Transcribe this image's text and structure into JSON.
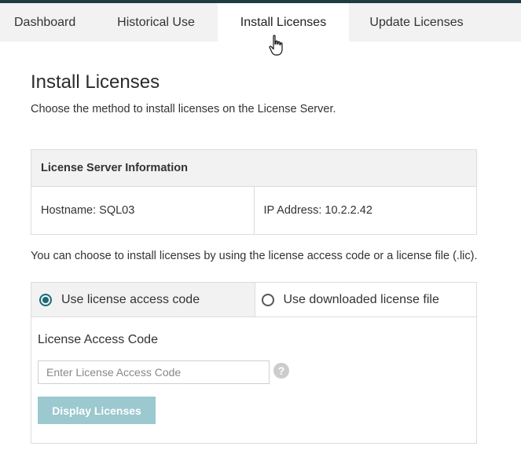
{
  "tabs": [
    {
      "label": "Dashboard",
      "active": false
    },
    {
      "label": "Historical Use",
      "active": false
    },
    {
      "label": "Install Licenses",
      "active": true
    },
    {
      "label": "Update Licenses",
      "active": false
    }
  ],
  "page": {
    "title": "Install Licenses",
    "subtitle": "Choose the method to install licenses on the License Server."
  },
  "server_info": {
    "header": "License Server Information",
    "hostname": "Hostname: SQL03",
    "ip_address": "IP Address: 10.2.2.42"
  },
  "choose_text": "You can choose to install licenses by using the license access code or a license file (.lic).",
  "methods": {
    "options": [
      {
        "label": "Use license access code",
        "selected": true
      },
      {
        "label": "Use downloaded license file",
        "selected": false
      }
    ]
  },
  "access_code": {
    "label": "License Access Code",
    "placeholder": "Enter License Access Code",
    "value": "",
    "help_icon": "question-circle-icon",
    "help_glyph": "?"
  },
  "display_button": {
    "label": "Display Licenses",
    "enabled": false
  },
  "colors": {
    "accent": "#1b6a7a",
    "top_bar": "#1f3b44",
    "button_disabled": "#9cc8cf",
    "tab_bg": "#f2f2f2"
  },
  "cursor": "hand-pointer-icon"
}
